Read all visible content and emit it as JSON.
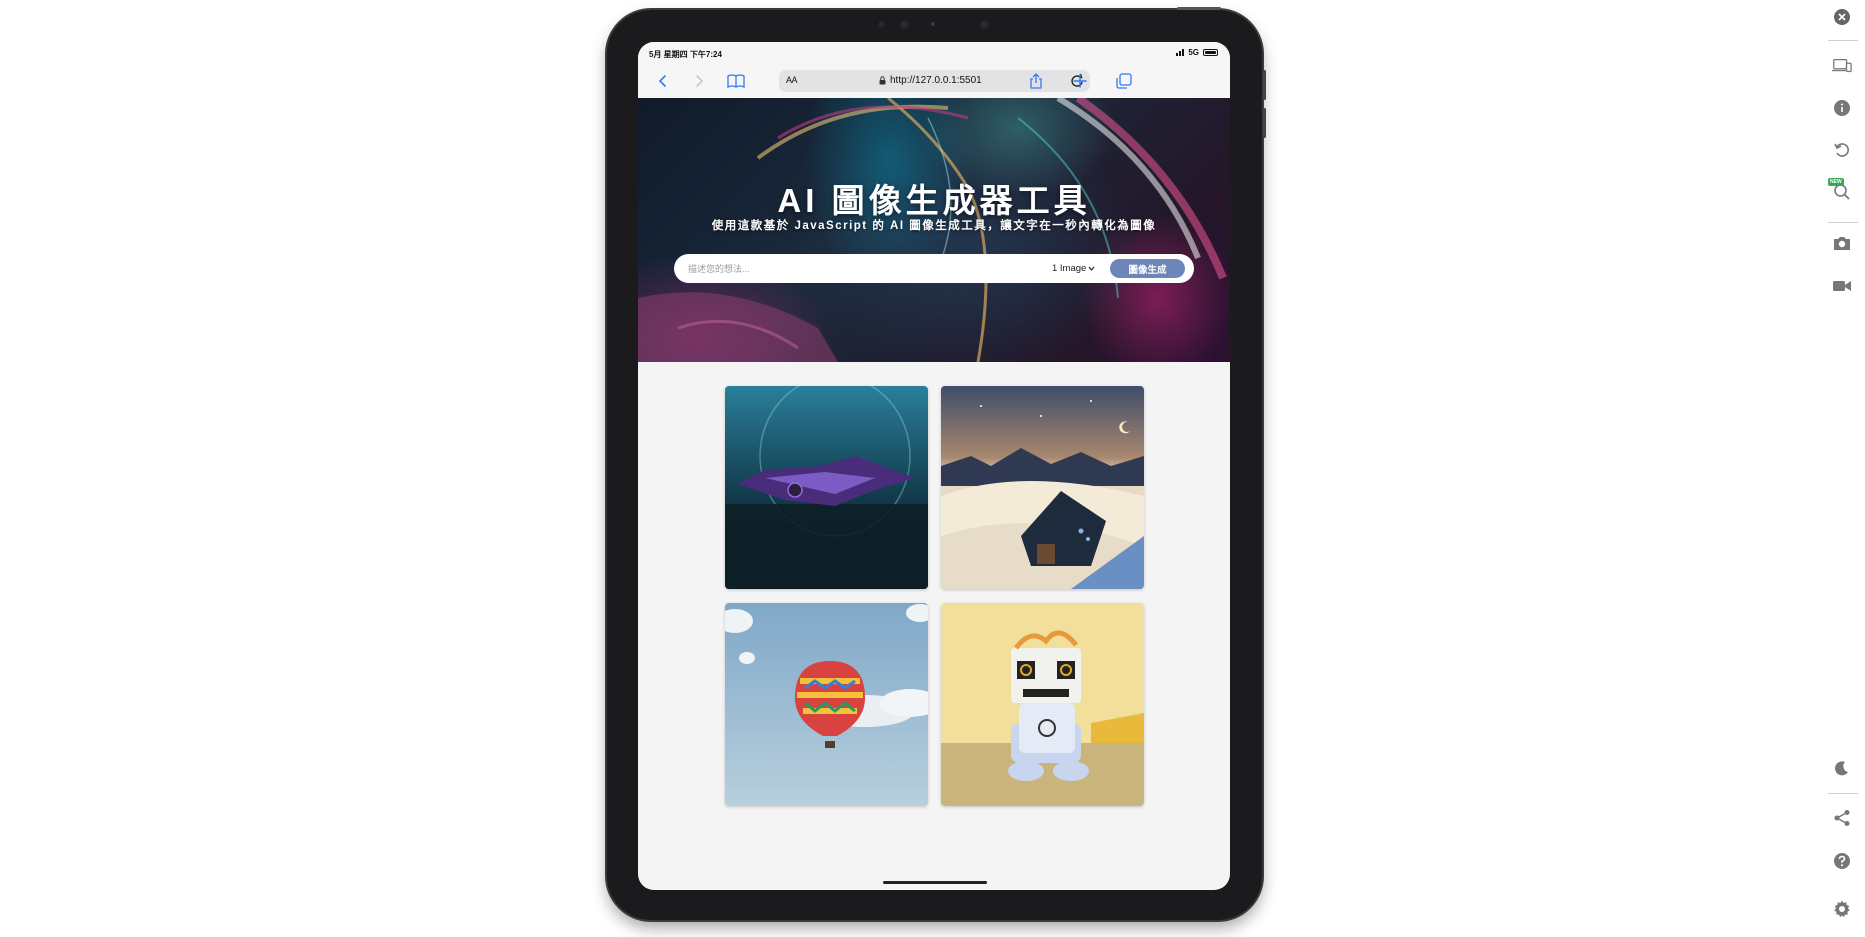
{
  "status_bar": {
    "time": "5月 星期四 下午7:24",
    "network": "5G"
  },
  "browser": {
    "text_size_label": "AA",
    "url": "http://127.0.0.1:5501"
  },
  "hero": {
    "title": "AI 圖像生成器工具",
    "subtitle": "使用這款基於 JavaScript 的 AI 圖像生成工具，讓文字在一秒內轉化為圖像",
    "prompt_placeholder": "描述您的想法...",
    "image_count": "1 Image",
    "generate_label": "圖像生成"
  },
  "gallery": {
    "images": [
      {
        "name": "purple-spaceship-image"
      },
      {
        "name": "snowy-cabin-night-image"
      },
      {
        "name": "hot-air-balloon-image"
      },
      {
        "name": "toy-robot-image"
      }
    ]
  },
  "sidebar": {
    "new_badge": "NEW",
    "icons": [
      "close-icon",
      "responsive-devices-icon",
      "info-icon",
      "rotate-icon",
      "zoom-icon",
      "screenshot-icon",
      "record-video-icon",
      "dark-mode-icon",
      "share-icon",
      "help-icon",
      "settings-icon"
    ]
  },
  "colors": {
    "accent": "#3478f6",
    "generate_button": "#6d85b7"
  }
}
